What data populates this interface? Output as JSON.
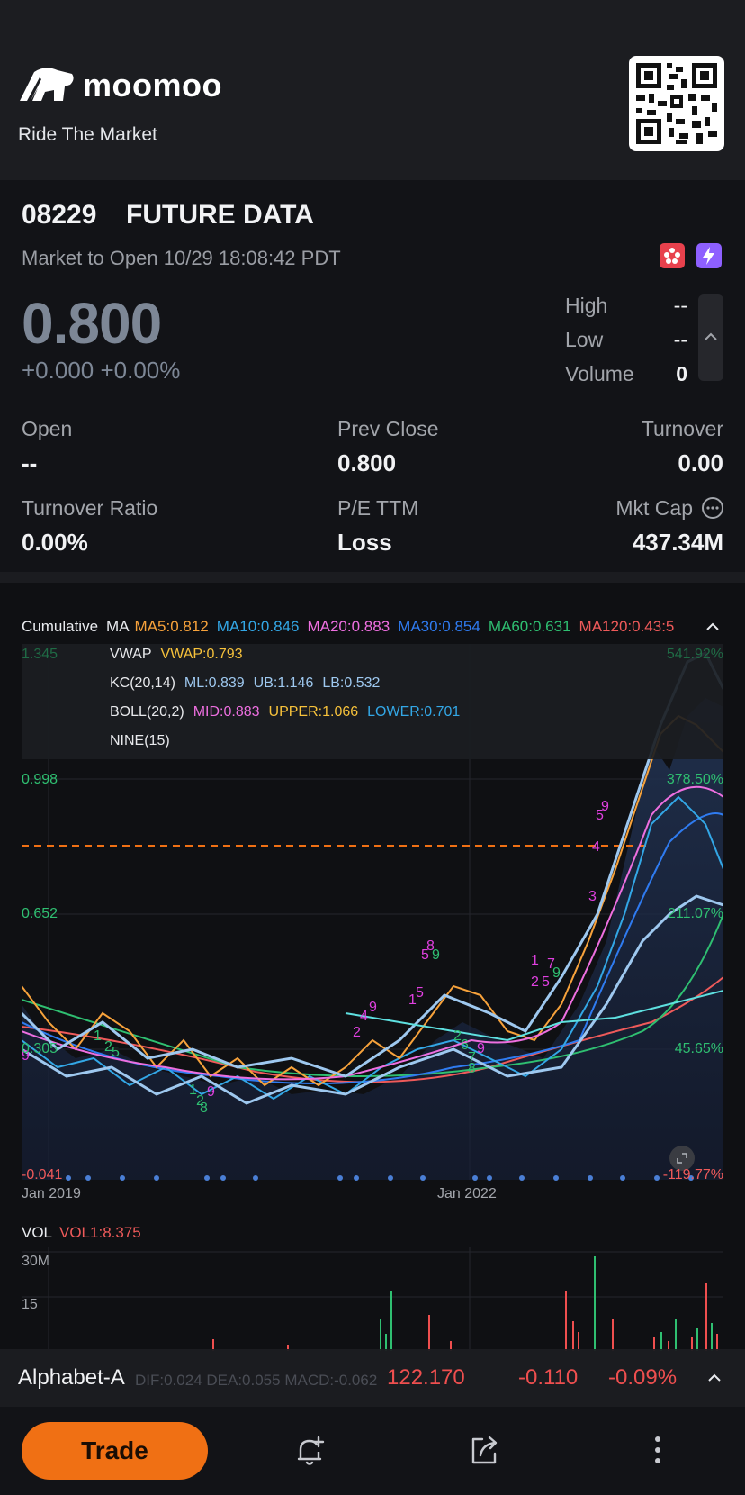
{
  "brand": {
    "name": "moomoo",
    "tagline": "Ride The Market"
  },
  "stock": {
    "code": "08229",
    "name": "FUTURE DATA",
    "status": "Market to Open 10/29 18:08:42 PDT",
    "price": "0.800",
    "change": "+0.000",
    "change_pct": "+0.00%",
    "price_color": "#7d8796"
  },
  "side_stats": [
    {
      "label": "High",
      "value": "--"
    },
    {
      "label": "Low",
      "value": "--"
    },
    {
      "label": "Volume",
      "value": "0"
    }
  ],
  "stats": {
    "open": {
      "label": "Open",
      "value": "--"
    },
    "prev_close": {
      "label": "Prev Close",
      "value": "0.800"
    },
    "turnover": {
      "label": "Turnover",
      "value": "0.00"
    },
    "turnover_ratio": {
      "label": "Turnover Ratio",
      "value": "0.00%"
    },
    "pe": {
      "label": "P/E TTM",
      "value": "Loss"
    },
    "mkt_cap": {
      "label": "Mkt Cap",
      "value": "437.34M"
    }
  },
  "indicators": {
    "mode": "Cumulative",
    "ma_label": "MA",
    "ma5": "MA5:0.812",
    "ma10": "MA10:0.846",
    "ma20": "MA20:0.883",
    "ma30": "MA30:0.854",
    "ma60": "MA60:0.631",
    "ma120": "MA120:0.43:5"
  },
  "overlay": {
    "vwap_name": "VWAP",
    "vwap": "VWAP:0.793",
    "kc_name": "KC(20,14)",
    "kc_ml": "ML:0.839",
    "kc_ub": "UB:1.146",
    "kc_lb": "LB:0.532",
    "boll_name": "BOLL(20,2)",
    "boll_mid": "MID:0.883",
    "boll_upper": "UPPER:1.066",
    "boll_lower": "LOWER:0.701",
    "nine": "NINE(15)"
  },
  "axis": {
    "y_left": [
      "1.345",
      "0.998",
      "0.652",
      "0.305",
      "-0.041"
    ],
    "y_right": [
      "541.92%",
      "378.50%",
      "211.07%",
      "45.65%",
      "-119.77%"
    ],
    "x_dates": [
      "Jan 2019",
      "Jan 2022"
    ]
  },
  "volume": {
    "label": "VOL",
    "value": "VOL1:8.375",
    "ticks": [
      "30M",
      "15"
    ]
  },
  "macd_ghost": "DIF:0.024  DEA:0.055  MACD:-0.062",
  "ticker": {
    "name": "Alphabet-A",
    "price": "122.170",
    "change": "-0.110",
    "change_pct": "-0.09%"
  },
  "bottom": {
    "trade_label": "Trade"
  },
  "colors": {
    "accent": "#f07014",
    "down": "#ef4f4f",
    "up": "#2fbf71",
    "ma5": "#f7a23b",
    "ma10": "#33a7e6",
    "ma20": "#ee6fe0",
    "ma30": "#2f7bf0",
    "ma60": "#2fbf71",
    "ma120": "#ef5a5a"
  },
  "chart_data": {
    "type": "line",
    "x_range": [
      "Jan 2019",
      "Oct 2024"
    ],
    "ylim": [
      -0.041,
      1.345
    ],
    "reference_line": 0.8,
    "series": [
      {
        "name": "MA5",
        "color": "#f7a23b"
      },
      {
        "name": "MA10",
        "color": "#33a7e6"
      },
      {
        "name": "MA20",
        "color": "#ee6fe0"
      },
      {
        "name": "MA30",
        "color": "#2f7bf0"
      },
      {
        "name": "MA60",
        "color": "#2fbf71"
      },
      {
        "name": "MA120",
        "color": "#ef5a5a"
      }
    ]
  }
}
